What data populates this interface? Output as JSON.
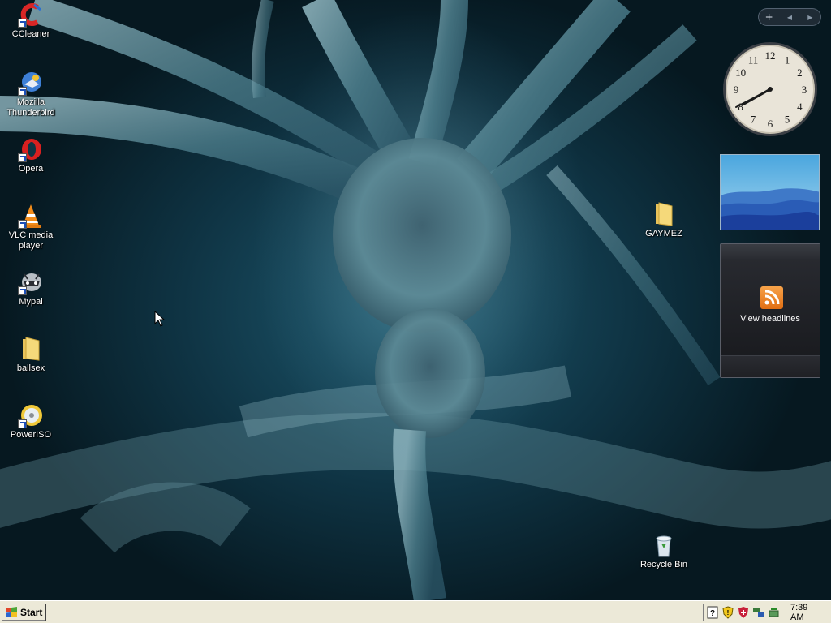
{
  "desktop": {
    "icons_left": [
      {
        "label": "CCleaner",
        "icon": "ccleaner-icon"
      },
      {
        "label": "Mozilla Thunderbird",
        "icon": "thunderbird-icon"
      },
      {
        "label": "Opera",
        "icon": "opera-icon"
      },
      {
        "label": "VLC media player",
        "icon": "vlc-icon"
      },
      {
        "label": "Mypal",
        "icon": "mypal-icon"
      },
      {
        "label": "ballsex",
        "icon": "folder-icon"
      },
      {
        "label": "PowerISO",
        "icon": "poweriso-icon"
      }
    ],
    "folder_right": {
      "label": "GAYMEZ",
      "icon": "folder-icon"
    },
    "recycle_bin": {
      "label": "Recycle Bin",
      "icon": "recycle-bin-icon"
    }
  },
  "sidebar": {
    "controls": {
      "add": "+",
      "prev": "◀",
      "next": "▶"
    },
    "clock": {
      "hour_numbers": [
        "12",
        "1",
        "2",
        "3",
        "4",
        "5",
        "6",
        "7",
        "8",
        "9",
        "10",
        "11"
      ]
    },
    "feed": {
      "label": "View headlines",
      "icon": "rss-icon"
    }
  },
  "taskbar": {
    "start_label": "Start",
    "tray_icons": [
      "help-icon",
      "security-shield-icon",
      "antivirus-icon",
      "network-icon",
      "safely-remove-icon"
    ],
    "time": "7:39 AM"
  },
  "colors": {
    "taskbar_bg": "#ece9d8",
    "wallpaper_dark": "#061820",
    "wallpaper_mid": "#1e5a70",
    "feed_accent": "#f08a2a"
  }
}
